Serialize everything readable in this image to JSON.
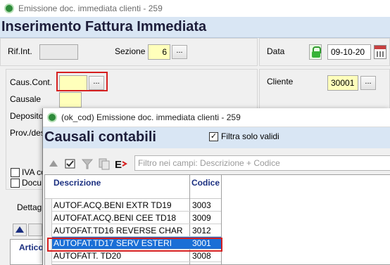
{
  "window": {
    "title": "Emissione doc. immediata clienti - 259",
    "page_title": "Inserimento Fattura Immediata"
  },
  "header_form": {
    "rif_int_label": "Rif.Int.",
    "rif_int_value": "",
    "sezione_label": "Sezione",
    "sezione_value": "6",
    "data_label": "Data",
    "data_value": "09-10-20"
  },
  "doc_form": {
    "caus_cont_label": "Caus.Cont.",
    "caus_cont_value": "",
    "causale_label": "Causale",
    "deposito_label": "Deposito",
    "prov_des_label": "Prov./des",
    "cliente_label": "Cliente",
    "cliente_value": "30001",
    "iva_label": "IVA co",
    "docu_label": "Docu"
  },
  "lower_tabs": {
    "dettaglio_label": "Dettag",
    "articoli_label": "Artico"
  },
  "buttons": {
    "dots": "..."
  },
  "popup": {
    "title": "(ok_cod) Emissione doc. immediata clienti - 259",
    "header": "Causali contabili",
    "filter_label": "Filtra solo validi",
    "filter_checked": true,
    "search_placeholder": "Filtro nei campi: Descrizione + Codice",
    "columns": {
      "descrizione": "Descrizione",
      "codice": "Codice"
    },
    "rows": [
      {
        "descrizione": "AUTOF.ACQ.BENI EXTR TD19",
        "codice": "3003",
        "selected": false
      },
      {
        "descrizione": "AUTOFAT.ACQ.BENI CEE TD18",
        "codice": "3009",
        "selected": false
      },
      {
        "descrizione": "AUTOFAT.TD16 REVERSE CHAR",
        "codice": "3012",
        "selected": false
      },
      {
        "descrizione": "AUTOFAT.TD17 SERV ESTERI",
        "codice": "3001",
        "selected": true
      },
      {
        "descrizione": "AUTOFATT. TD20",
        "codice": "3008",
        "selected": false
      }
    ]
  },
  "colors": {
    "header_bg": "#d9e6f4",
    "selected_row": "#1a6fd6",
    "highlight": "#d62020",
    "yellow_field": "#ffffbb"
  }
}
